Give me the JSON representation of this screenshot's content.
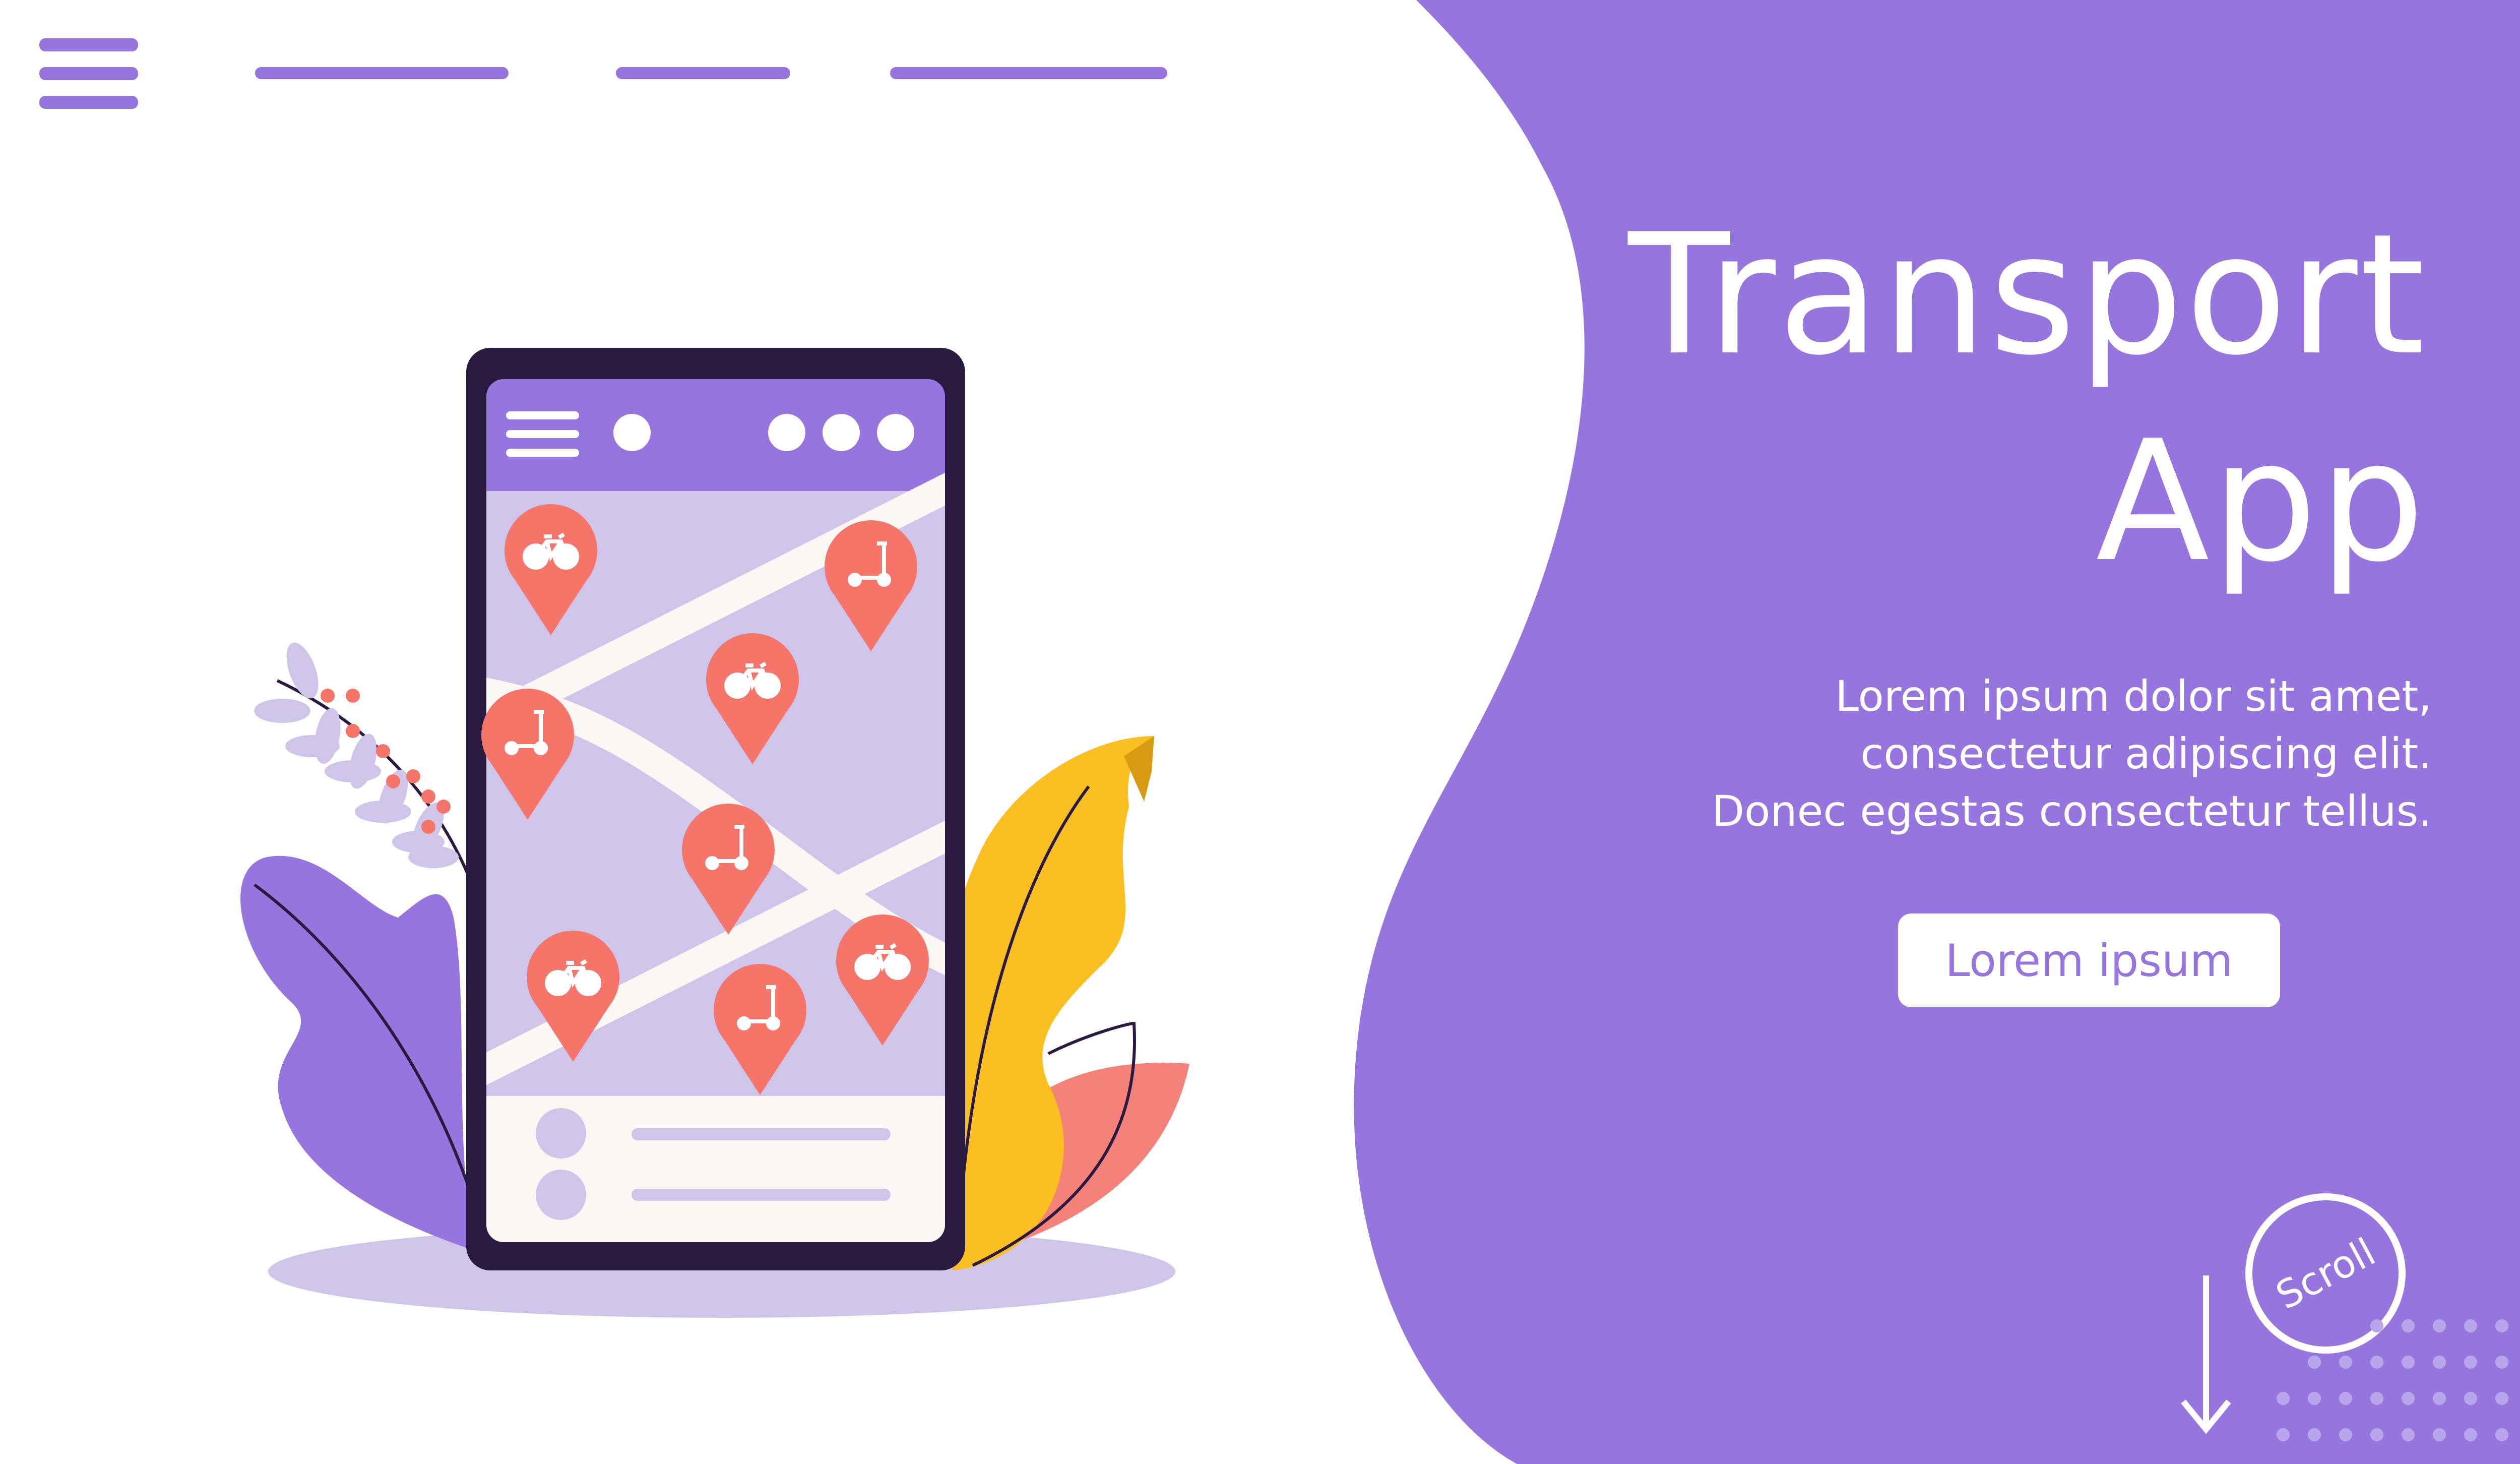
{
  "colors": {
    "purple": "#9775df",
    "phone_frame": "#2a1a3f",
    "lavender": "#cfc5ea",
    "pin": "#f5756a",
    "yellow": "#fbbf22",
    "salmon": "#f5827a",
    "list_bg": "#fbf7f4"
  },
  "nav": {
    "menu_icon": "hamburger-menu-icon",
    "links": [
      "",
      "",
      ""
    ]
  },
  "hero": {
    "title_line1": "Transport",
    "title_line2": "App",
    "description": [
      "Lorem ipsum dolor sit amet,",
      "consectetur adipiscing elit.",
      "Donec egestas consectetur tellus."
    ],
    "cta_label": "Lorem ipsum",
    "scroll_label": "Scroll"
  },
  "phone": {
    "header_icons": [
      "hamburger-menu-icon",
      "dot-icon",
      "more-dots-icon"
    ],
    "pins": [
      {
        "type": "bicycle"
      },
      {
        "type": "scooter"
      },
      {
        "type": "bicycle"
      },
      {
        "type": "scooter"
      },
      {
        "type": "scooter"
      },
      {
        "type": "bicycle"
      },
      {
        "type": "bicycle"
      },
      {
        "type": "scooter"
      }
    ],
    "list_items": 2
  }
}
